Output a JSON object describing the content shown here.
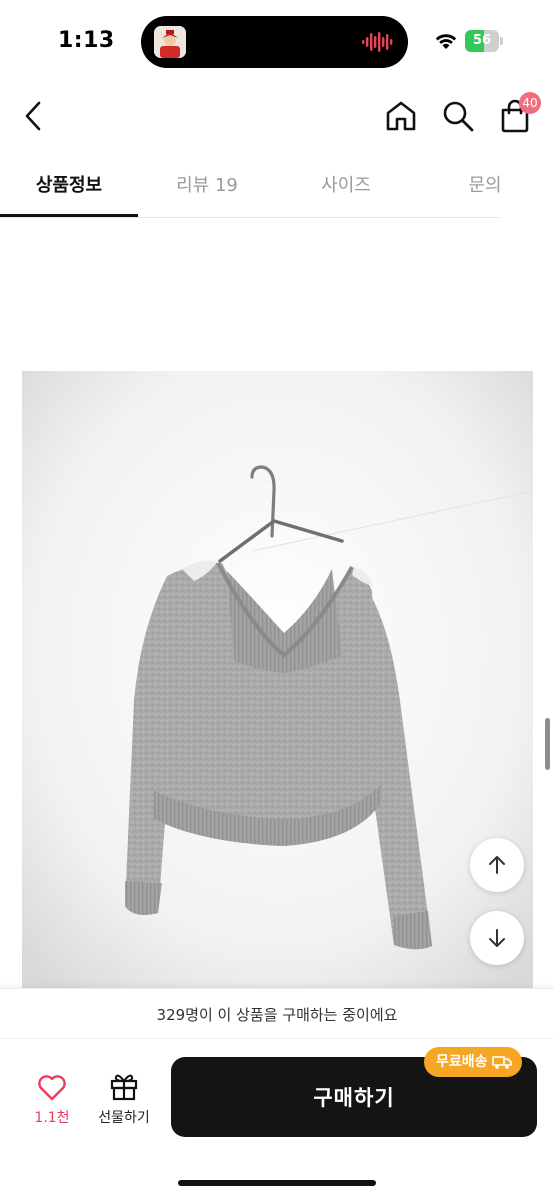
{
  "status_bar": {
    "time": "1:13",
    "battery": "56",
    "battery_level_percent": 56
  },
  "header": {
    "back_icon": "chevron-left-icon",
    "home_icon": "home-icon",
    "search_icon": "search-icon",
    "cart_icon": "shopping-bag-icon",
    "cart_count": "40"
  },
  "tabs": [
    {
      "label": "상품정보",
      "active": true
    },
    {
      "label": "리뷰 19",
      "active": false
    },
    {
      "label": "사이즈",
      "active": false
    },
    {
      "label": "문의",
      "active": false
    }
  ],
  "float_buttons": {
    "up_icon": "arrow-up-icon",
    "down_icon": "arrow-down-icon"
  },
  "notice": "329명이 이 상품을 구매하는 중이에요",
  "bottom_bar": {
    "like_count": "1.1천",
    "gift_label": "선물하기",
    "buy_label": "구매하기",
    "free_shipping_label": "무료배송"
  },
  "colors": {
    "accent_pink": "#ef3b5a",
    "badge": "#f26d7d",
    "buy_button": "#141414",
    "free_shipping": "#f6a623",
    "battery_fill": "#34c759"
  }
}
